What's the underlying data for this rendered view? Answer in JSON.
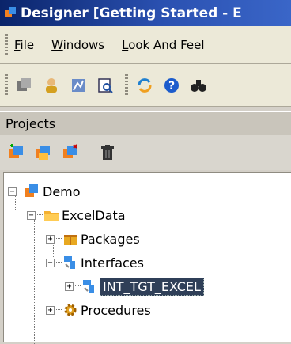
{
  "window": {
    "title": "Designer [Getting Started - E"
  },
  "menu": {
    "items": [
      {
        "label_pre": "",
        "label_u": "F",
        "label_post": "ile"
      },
      {
        "label_pre": "",
        "label_u": "W",
        "label_post": "indows"
      },
      {
        "label_pre": "",
        "label_u": "L",
        "label_post": "ook And Feel"
      }
    ]
  },
  "toolbar": {
    "buttons": [
      "models-icon",
      "user-icon",
      "topology-icon",
      "search-list-icon",
      "refresh-icon",
      "help-icon",
      "binoculars-icon"
    ]
  },
  "projects": {
    "header": "Projects",
    "tools": [
      "insert-project-icon",
      "insert-folder-icon",
      "insert-item-icon",
      "delete-icon"
    ],
    "tree": {
      "root": {
        "label": "Demo",
        "expander": "−"
      },
      "folder": {
        "label": "ExcelData",
        "expander": "−"
      },
      "packages": {
        "label": "Packages",
        "expander": "+"
      },
      "interfaces": {
        "label": "Interfaces",
        "expander": "−"
      },
      "interface_item": {
        "label": "INT_TGT_EXCEL",
        "expander": "+"
      },
      "procedures": {
        "label": "Procedures",
        "expander": "+"
      }
    }
  },
  "colors": {
    "title_bar": "#0a246a",
    "selection": "#2f3f58",
    "panel": "#d4d0c8"
  }
}
